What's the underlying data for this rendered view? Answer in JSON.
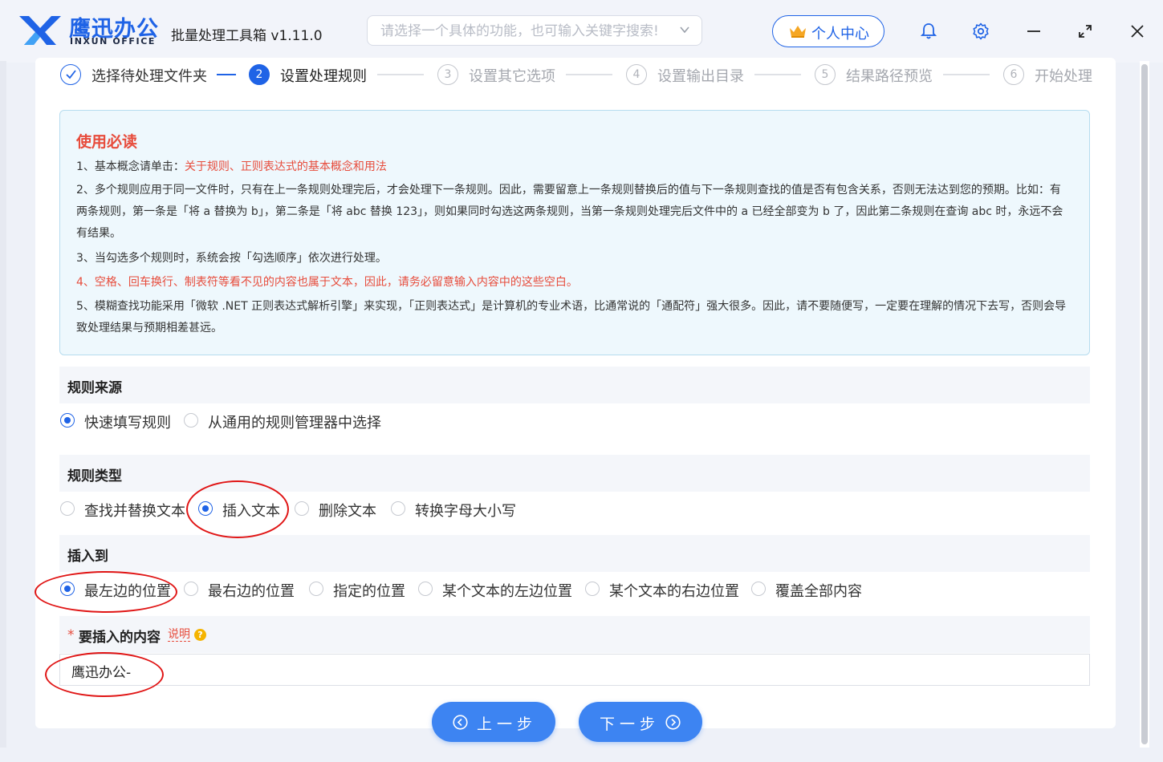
{
  "app": {
    "logo_cn": "鹰迅办公",
    "logo_en": "INXUN OFFICE",
    "title": "批量处理工具箱 v1.11.0",
    "search_placeholder": "请选择一个具体的功能，也可输入关键字搜索!",
    "user_center": "个人中心",
    "brand_color": "#1f63e6"
  },
  "steps": [
    {
      "num": "",
      "label": "选择待处理文件夹",
      "state": "done"
    },
    {
      "num": "2",
      "label": "设置处理规则",
      "state": "active"
    },
    {
      "num": "3",
      "label": "设置其它选项",
      "state": "todo"
    },
    {
      "num": "4",
      "label": "设置输出目录",
      "state": "todo"
    },
    {
      "num": "5",
      "label": "结果路径预览",
      "state": "todo"
    },
    {
      "num": "6",
      "label": "开始处理",
      "state": "todo"
    }
  ],
  "notice": {
    "title": "使用必读",
    "line1_prefix": "1、基本概念请单击：",
    "line1_link": "关于规则、正则表达式的基本概念和用法",
    "line2": "2、多个规则应用于同一文件时，只有在上一条规则处理完后，才会处理下一条规则。因此，需要留意上一条规则替换后的值与下一条规则查找的值是否有包含关系，否则无法达到您的预期。比如：有两条规则，第一条是「将 a 替换为 b」，第二条是「将 abc 替换 123」，则如果同时勾选这两条规则，当第一条规则处理完后文件中的 a 已经全部变为 b 了，因此第二条规则在查询 abc 时，永远不会有结果。",
    "line3": "3、当勾选多个规则时，系统会按「勾选顺序」依次进行处理。",
    "line4": "4、空格、回车换行、制表符等看不见的内容也属于文本，因此，请务必留意输入内容中的这些空白。",
    "line5": "5、模糊查找功能采用「微软 .NET 正则表达式解析引擎」来实现，「正则表达式」是计算机的专业术语，比通常说的「通配符」强大很多。因此，请不要随便写，一定要在理解的情况下去写，否则会导致处理结果与预期相差甚远。"
  },
  "rule_source": {
    "title": "规则来源",
    "options": [
      "快速填写规则",
      "从通用的规则管理器中选择"
    ],
    "selected": 0
  },
  "rule_type": {
    "title": "规则类型",
    "options": [
      "查找并替换文本",
      "插入文本",
      "删除文本",
      "转换字母大小写"
    ],
    "selected": 1
  },
  "insert_to": {
    "title": "插入到",
    "options": [
      "最左边的位置",
      "最右边的位置",
      "指定的位置",
      "某个文本的左边位置",
      "某个文本的右边位置",
      "覆盖全部内容"
    ],
    "selected": 0
  },
  "content": {
    "star": "*",
    "label": "要插入的内容",
    "help": "说明",
    "help_icon": "?",
    "value": "鹰迅办公-"
  },
  "nav": {
    "prev": "上一步",
    "next": "下一步"
  }
}
